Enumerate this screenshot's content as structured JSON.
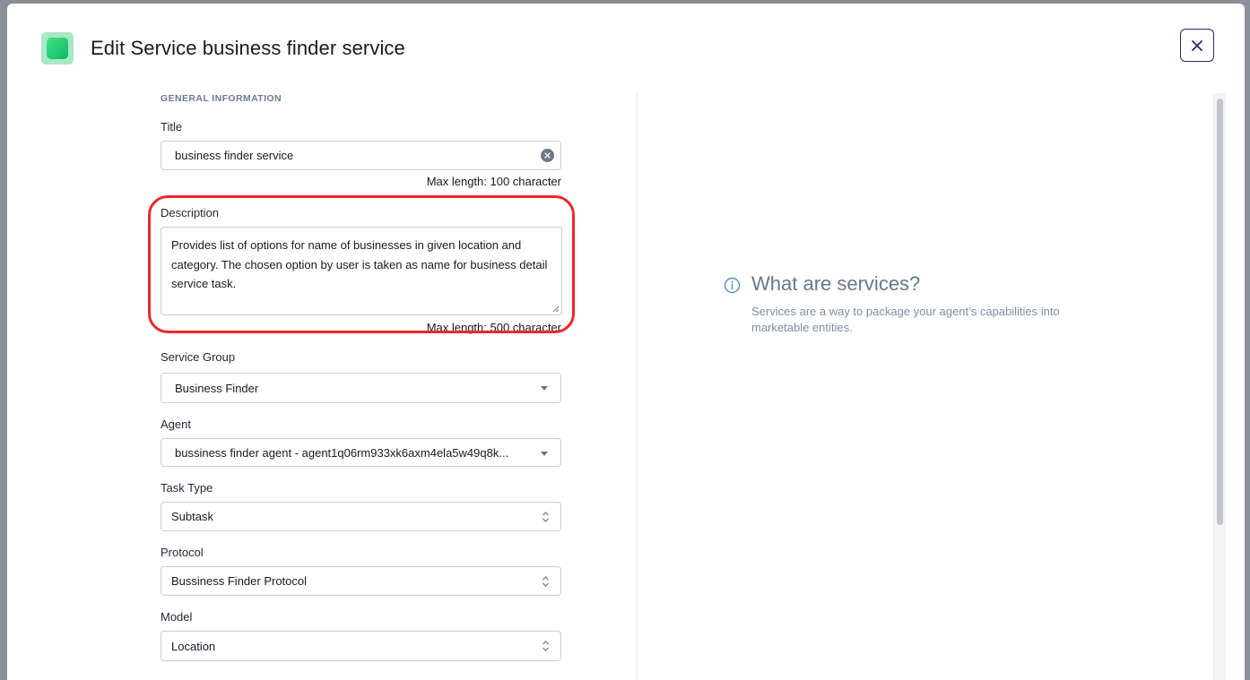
{
  "header": {
    "title": "Edit Service business finder service",
    "close_icon": "close-icon"
  },
  "form": {
    "section_title": "GENERAL INFORMATION",
    "title_field": {
      "label": "Title",
      "value": "business finder service",
      "helper": "Max length: 100 character"
    },
    "description_field": {
      "label": "Description",
      "value": "Provides list of options for name of businesses in given location and category. The chosen option by user is taken as name for business detail service task.",
      "helper": "Max length: 500 character",
      "highlight_color": "#f0262b"
    },
    "service_group": {
      "label": "Service Group",
      "value": "Business Finder"
    },
    "agent": {
      "label": "Agent",
      "value": "bussiness finder agent - agent1q06rm933xk6axm4ela5w49q8k..."
    },
    "task_type": {
      "label": "Task Type",
      "value": "Subtask"
    },
    "protocol": {
      "label": "Protocol",
      "value": "Bussiness Finder Protocol"
    },
    "model": {
      "label": "Model",
      "value": "Location"
    }
  },
  "info_panel": {
    "icon": "info-icon",
    "title": "What are services?",
    "text": "Services are a way to package your agent’s capabilities into marketable entities."
  },
  "colors": {
    "accent": "#1f2f6e",
    "brand_green": "#12b461",
    "highlight": "#f0262b"
  }
}
